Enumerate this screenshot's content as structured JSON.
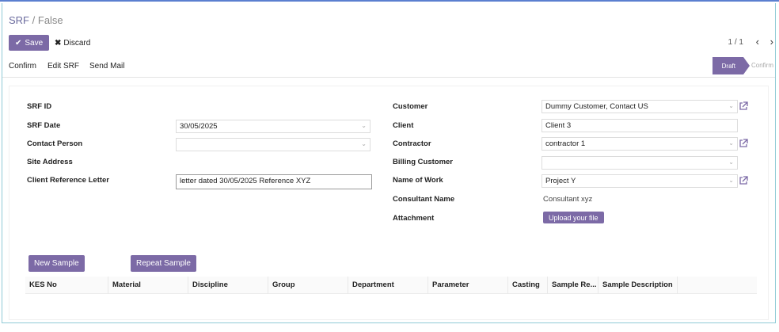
{
  "breadcrumb": {
    "parent": "SRF",
    "separator": "/",
    "current": "False"
  },
  "toolbar": {
    "save_label": "Save",
    "discard_label": "Discard"
  },
  "pager": {
    "text": "1 / 1",
    "prev": "‹",
    "next": "›"
  },
  "actions": {
    "confirm": "Confirm",
    "edit_srf": "Edit SRF",
    "send_mail": "Send Mail"
  },
  "status": {
    "draft": "Draft",
    "confirm": "Confirm"
  },
  "form": {
    "left": {
      "srf_id_label": "SRF ID",
      "srf_date_label": "SRF Date",
      "srf_date_value": "30/05/2025",
      "contact_person_label": "Contact Person",
      "contact_person_value": "",
      "site_address_label": "Site Address",
      "client_ref_label": "Client Reference Letter",
      "client_ref_value": "letter dated 30/05/2025 Reference XYZ"
    },
    "right": {
      "customer_label": "Customer",
      "customer_value": "Dummy Customer, Contact US",
      "client_label": "Client",
      "client_value": "Client 3",
      "contractor_label": "Contractor",
      "contractor_value": "contractor 1",
      "billing_customer_label": "Billing Customer",
      "billing_customer_value": "",
      "name_of_work_label": "Name of Work",
      "name_of_work_value": "Project Y",
      "consultant_label": "Consultant Name",
      "consultant_value": "Consultant xyz",
      "attachment_label": "Attachment",
      "upload_label": "Upload your file"
    }
  },
  "samples": {
    "new_sample_label": "New Sample",
    "repeat_sample_label": "Repeat Sample",
    "columns": [
      "KES No",
      "Material",
      "Discipline",
      "Group",
      "Department",
      "Parameter",
      "Casting",
      "Sample Re...",
      "Sample Description"
    ]
  },
  "colors": {
    "accent": "#7c6aa6",
    "breadcrumb": "#6b6b9e",
    "top_border": "#5b7fd0"
  }
}
